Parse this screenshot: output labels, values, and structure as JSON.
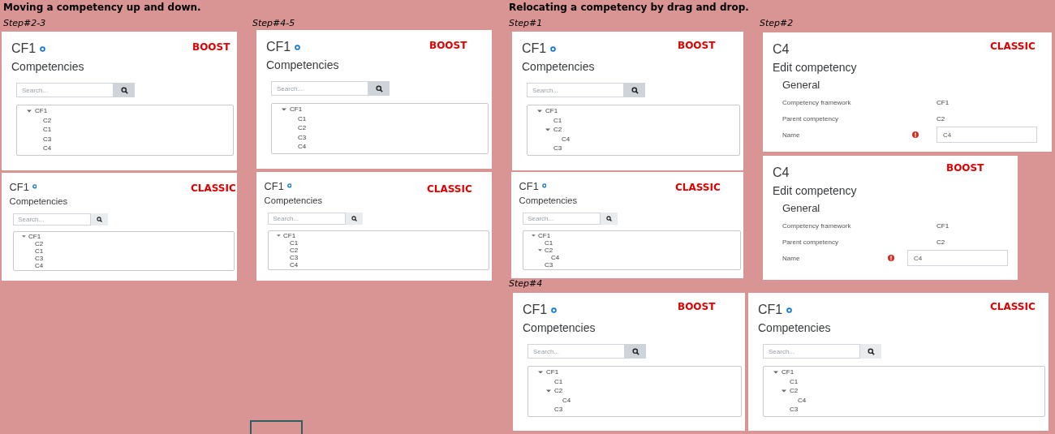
{
  "sections": [
    {
      "heading": "Moving a competency up and down.",
      "steps": [
        {
          "label": "Step#2-3",
          "panels": [
            {
              "kind": "tree",
              "badge": "BOOST",
              "title": "CF1",
              "subtitle": "Competencies",
              "search": {
                "placeholder": "Search..."
              },
              "tree": [
                {
                  "label": "CF1",
                  "expanded": true,
                  "children": [
                    {
                      "label": "C2"
                    },
                    {
                      "label": "C1"
                    },
                    {
                      "label": "C3"
                    },
                    {
                      "label": "C4"
                    }
                  ]
                }
              ]
            },
            {
              "kind": "tree",
              "badge": "CLASSIC",
              "title": "CF1",
              "subtitle": "Competencies",
              "search": {
                "placeholder": "Search..."
              },
              "tree": [
                {
                  "label": "CF1",
                  "expanded": true,
                  "children": [
                    {
                      "label": "C2"
                    },
                    {
                      "label": "C1"
                    },
                    {
                      "label": "C3"
                    },
                    {
                      "label": "C4"
                    }
                  ]
                }
              ]
            }
          ]
        },
        {
          "label": "Step#4-5",
          "panels": [
            {
              "kind": "tree",
              "badge": "BOOST",
              "title": "CF1",
              "subtitle": "Competencies",
              "search": {
                "placeholder": "Search..."
              },
              "tree": [
                {
                  "label": "CF1",
                  "expanded": true,
                  "children": [
                    {
                      "label": "C1"
                    },
                    {
                      "label": "C2"
                    },
                    {
                      "label": "C3"
                    },
                    {
                      "label": "C4"
                    }
                  ]
                }
              ]
            },
            {
              "kind": "tree",
              "badge": "CLASSIC",
              "title": "CF1",
              "subtitle": "Competencies",
              "search": {
                "placeholder": "Search..."
              },
              "tree": [
                {
                  "label": "CF1",
                  "expanded": true,
                  "children": [
                    {
                      "label": "C1"
                    },
                    {
                      "label": "C2"
                    },
                    {
                      "label": "C3"
                    },
                    {
                      "label": "C4"
                    }
                  ]
                }
              ]
            }
          ]
        }
      ]
    },
    {
      "heading": "Relocating a competency by drag and drop.",
      "steps": [
        {
          "label": "Step#1",
          "panels": [
            {
              "kind": "tree",
              "badge": "BOOST",
              "title": "CF1",
              "subtitle": "Competencies",
              "search": {
                "placeholder": "Search..."
              },
              "tree": [
                {
                  "label": "CF1",
                  "expanded": true,
                  "children": [
                    {
                      "label": "C1"
                    },
                    {
                      "label": "C2",
                      "expanded": true,
                      "children": [
                        {
                          "label": "C4"
                        }
                      ]
                    },
                    {
                      "label": "C3"
                    }
                  ]
                }
              ]
            },
            {
              "kind": "tree",
              "badge": "CLASSIC",
              "title": "CF1",
              "subtitle": "Competencies",
              "search": {
                "placeholder": "Search..."
              },
              "tree": [
                {
                  "label": "CF1",
                  "expanded": true,
                  "children": [
                    {
                      "label": "C1"
                    },
                    {
                      "label": "C2",
                      "expanded": true,
                      "children": [
                        {
                          "label": "C4"
                        }
                      ]
                    },
                    {
                      "label": "C3"
                    }
                  ]
                }
              ]
            }
          ]
        },
        {
          "label": "Step#2",
          "panels": [
            {
              "kind": "edit",
              "badge": "CLASSIC",
              "title": "C4",
              "subtitle": "Edit competency",
              "section": "General",
              "fields": [
                {
                  "kind": "static",
                  "label": "Competency framework",
                  "value": "CF1"
                },
                {
                  "kind": "static",
                  "label": "Parent competency",
                  "value": "C2"
                },
                {
                  "kind": "input",
                  "label": "Name",
                  "required": true,
                  "value": "C4"
                }
              ]
            },
            {
              "kind": "edit",
              "badge": "BOOST",
              "title": "C4",
              "subtitle": "Edit competency",
              "section": "General",
              "fields": [
                {
                  "kind": "static",
                  "label": "Competency framework",
                  "value": "CF1"
                },
                {
                  "kind": "static",
                  "label": "Parent competency",
                  "value": "C2"
                },
                {
                  "kind": "input",
                  "label": "Name",
                  "required": true,
                  "value": "C4"
                }
              ]
            }
          ]
        },
        {
          "label": "Step#4",
          "panels": [
            {
              "kind": "tree",
              "badge": "BOOST",
              "title": "CF1",
              "subtitle": "Competencies",
              "search": {
                "placeholder": "Search..."
              },
              "tree": [
                {
                  "label": "CF1",
                  "expanded": true,
                  "children": [
                    {
                      "label": "C1"
                    },
                    {
                      "label": "C2",
                      "expanded": true,
                      "children": [
                        {
                          "label": "C4"
                        }
                      ]
                    },
                    {
                      "label": "C3"
                    }
                  ]
                }
              ]
            },
            {
              "kind": "tree",
              "badge": "CLASSIC",
              "title": "CF1",
              "subtitle": "Competencies",
              "search": {
                "placeholder": "Search..."
              },
              "tree": [
                {
                  "label": "CF1",
                  "expanded": true,
                  "children": [
                    {
                      "label": "C1"
                    },
                    {
                      "label": "C2",
                      "expanded": true,
                      "children": [
                        {
                          "label": "C4"
                        }
                      ]
                    },
                    {
                      "label": "C3"
                    }
                  ]
                }
              ]
            }
          ]
        }
      ]
    }
  ]
}
